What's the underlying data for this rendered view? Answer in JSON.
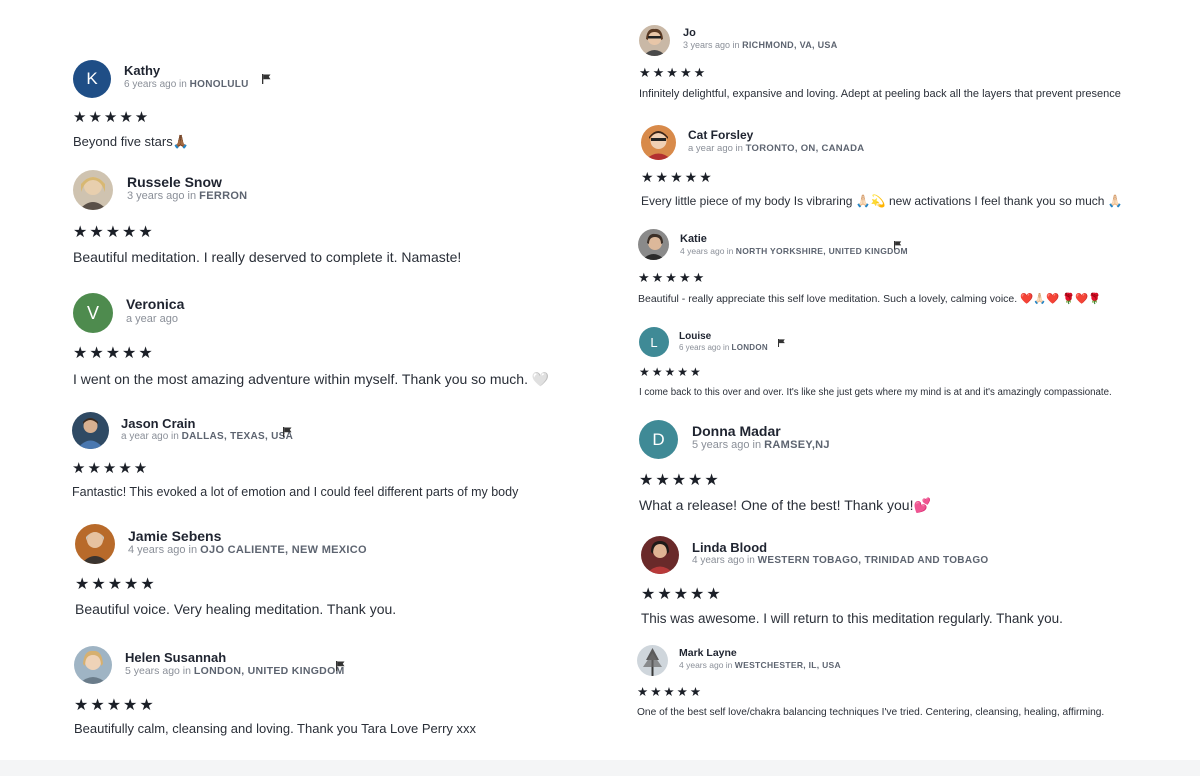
{
  "reviews_left": [
    {
      "name": "Kathy",
      "time": "6 years ago",
      "in": "in",
      "location": "HONOLULU",
      "initial": "K",
      "avatar_color": "#1f4e86",
      "stars": "★★★★★",
      "text": "Beyond five stars🙏🏾"
    },
    {
      "name": "Russele Snow",
      "time": "3 years ago",
      "in": "in",
      "location": "FERRON",
      "stars": "★★★★★",
      "text": "Beautiful meditation. I really deserved to complete it. Namaste!"
    },
    {
      "name": "Veronica",
      "time": "a year ago",
      "initial": "V",
      "avatar_color": "#4e8b4e",
      "stars": "★★★★★",
      "text": "I went on the most amazing adventure within myself. Thank you so much. 🤍"
    },
    {
      "name": "Jason Crain",
      "time": "a year ago",
      "in": "in",
      "location": "DALLAS, TEXAS, USA",
      "stars": "★★★★★",
      "text": "Fantastic! This evoked a lot of emotion and I could feel different parts of my body"
    },
    {
      "name": "Jamie Sebens",
      "time": "4 years ago",
      "in": "in",
      "location": "OJO CALIENTE, NEW MEXICO",
      "stars": "★★★★★",
      "text": "Beautiful voice. Very healing meditation. Thank you."
    },
    {
      "name": "Helen Susannah",
      "time": "5 years ago",
      "in": "in",
      "location": "LONDON, UNITED KINGDOM",
      "stars": "★★★★★",
      "text": "Beautifully calm, cleansing and loving. Thank you Tara Love Perry xxx"
    }
  ],
  "reviews_right": [
    {
      "name": "Jo",
      "time": "3 years ago",
      "in": "in",
      "location": "RICHMOND, VA, USA",
      "stars": "★★★★★",
      "text": "Infinitely delightful, expansive and loving. Adept at peeling back all the layers that prevent presence"
    },
    {
      "name": "Cat Forsley",
      "time": "a year ago",
      "in": "in",
      "location": "TORONTO, ON, CANADA",
      "stars": "★★★★★",
      "text": "Every little piece of my body Is vibraring 🙏🏻💫 new activations I feel thank you so much 🙏🏻"
    },
    {
      "name": "Katie",
      "time": "4 years ago",
      "in": "in",
      "location": "NORTH YORKSHIRE, UNITED KINGDOM",
      "stars": "★★★★★",
      "text": "Beautiful - really appreciate this self love meditation. Such a lovely, calming voice. ❤️🙏🏻❤️ 🌹❤️🌹"
    },
    {
      "name": "Louise",
      "time": "6 years ago",
      "in": "in",
      "location": "LONDON",
      "initial": "L",
      "avatar_color": "#3f8a96",
      "stars": "★★★★★",
      "text": "I come back to this over and over. It's like she just gets where my mind is at and it's amazingly compassionate."
    },
    {
      "name": "Donna Madar",
      "time": "5 years ago",
      "in": "in",
      "location": "RAMSEY,NJ",
      "initial": "D",
      "avatar_color": "#3f8a96",
      "stars": "★★★★★",
      "text": "What a release! One of the best! Thank you!💕"
    },
    {
      "name": "Linda Blood",
      "time": "4 years ago",
      "in": "in",
      "location": "WESTERN TOBAGO, TRINIDAD AND TOBAGO",
      "stars": "★★★★★",
      "text": "This was awesome. I will return to this meditation regularly. Thank you."
    },
    {
      "name": "Mark Layne",
      "time": "4 years ago",
      "in": "in",
      "location": "WESTCHESTER, IL, USA",
      "stars": "★★★★★",
      "text": "One of the best self love/chakra balancing techniques I've tried. Centering, cleansing, healing, affirming."
    }
  ]
}
